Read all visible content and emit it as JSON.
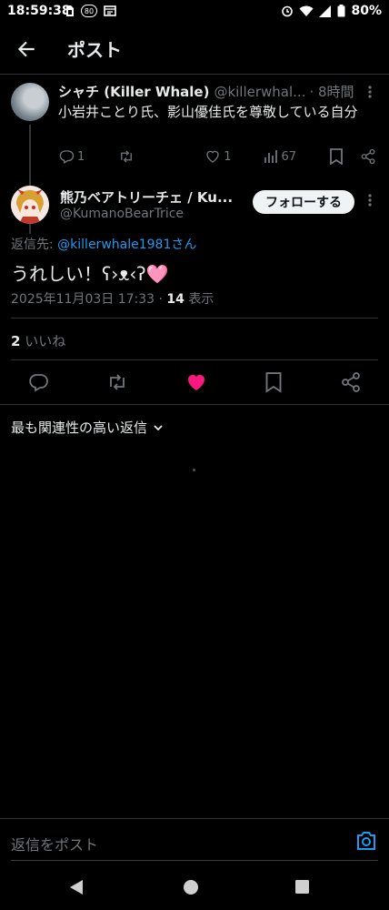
{
  "status": {
    "time": "18:59:38",
    "battery": "80%",
    "nfc_label": "80"
  },
  "header": {
    "title": "ポスト"
  },
  "parent": {
    "name": "シャチ (Killer Whale)",
    "handle": "@killerwhal...",
    "time": "· 8時間",
    "text": "小岩井ことり氏、影山優佳氏を尊敬している自分",
    "replies": "1",
    "likes": "1",
    "views": "67"
  },
  "main": {
    "name": "熊乃ベアトリーチェ / Ku...",
    "handle": "@KumanoBearTrice",
    "follow_label": "フォローする",
    "reply_to_prefix": "返信先: ",
    "reply_to_handle": "@killerwhale1981さん",
    "text": "うれしい！ʕ›ᴥ‹ʔ🩷",
    "date": "2025年11月03日 17:33 · ",
    "views_count": "14",
    "views_label": " 表示",
    "likes_count": "2",
    "likes_label": " いいね"
  },
  "sort": {
    "label": "最も関連性の高い返信"
  },
  "composer": {
    "placeholder": "返信をポスト"
  },
  "colors": {
    "accent": "#1d9bf0",
    "like": "#f91880",
    "muted": "#71767b",
    "border": "#2f3336"
  }
}
